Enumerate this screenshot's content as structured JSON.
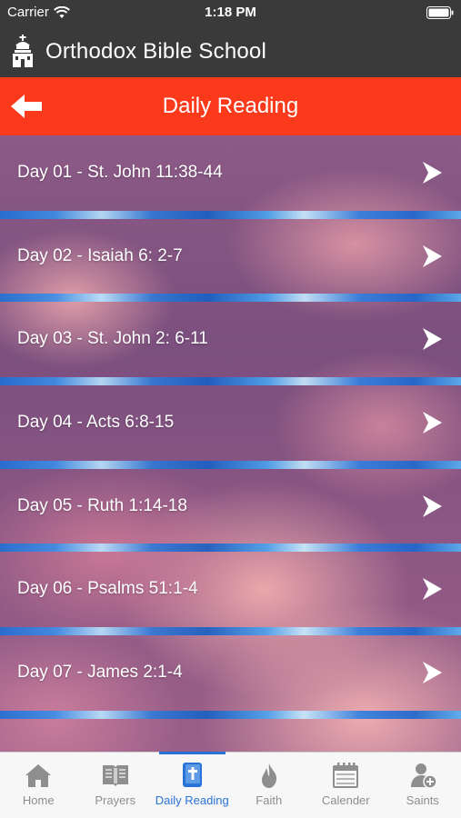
{
  "status_bar": {
    "carrier": "Carrier",
    "time": "1:18 PM"
  },
  "app": {
    "title": "Orthodox Bible School"
  },
  "header": {
    "title": "Daily Reading"
  },
  "readings": [
    {
      "label": "Day 01 - St. John 11:38-44"
    },
    {
      "label": "Day 02 - Isaiah 6: 2-7"
    },
    {
      "label": "Day 03 - St. John 2: 6-11"
    },
    {
      "label": "Day 04 - Acts 6:8-15"
    },
    {
      "label": "Day 05 - Ruth 1:14-18"
    },
    {
      "label": "Day 06 - Psalms 51:1-4"
    },
    {
      "label": "Day 07 - James 2:1-4"
    }
  ],
  "tabs": [
    {
      "label": "Home",
      "icon": "home-icon"
    },
    {
      "label": "Prayers",
      "icon": "book-icon"
    },
    {
      "label": "Daily Reading",
      "icon": "bible-icon",
      "active": true
    },
    {
      "label": "Faith",
      "icon": "flame-icon"
    },
    {
      "label": "Calender",
      "icon": "calendar-icon"
    },
    {
      "label": "Saints",
      "icon": "person-add-icon"
    }
  ],
  "colors": {
    "header": "#fb3a1c",
    "app_bar": "#3a3a3a",
    "active_tab": "#2a73d6",
    "inactive_tab": "#8e8e8e"
  }
}
